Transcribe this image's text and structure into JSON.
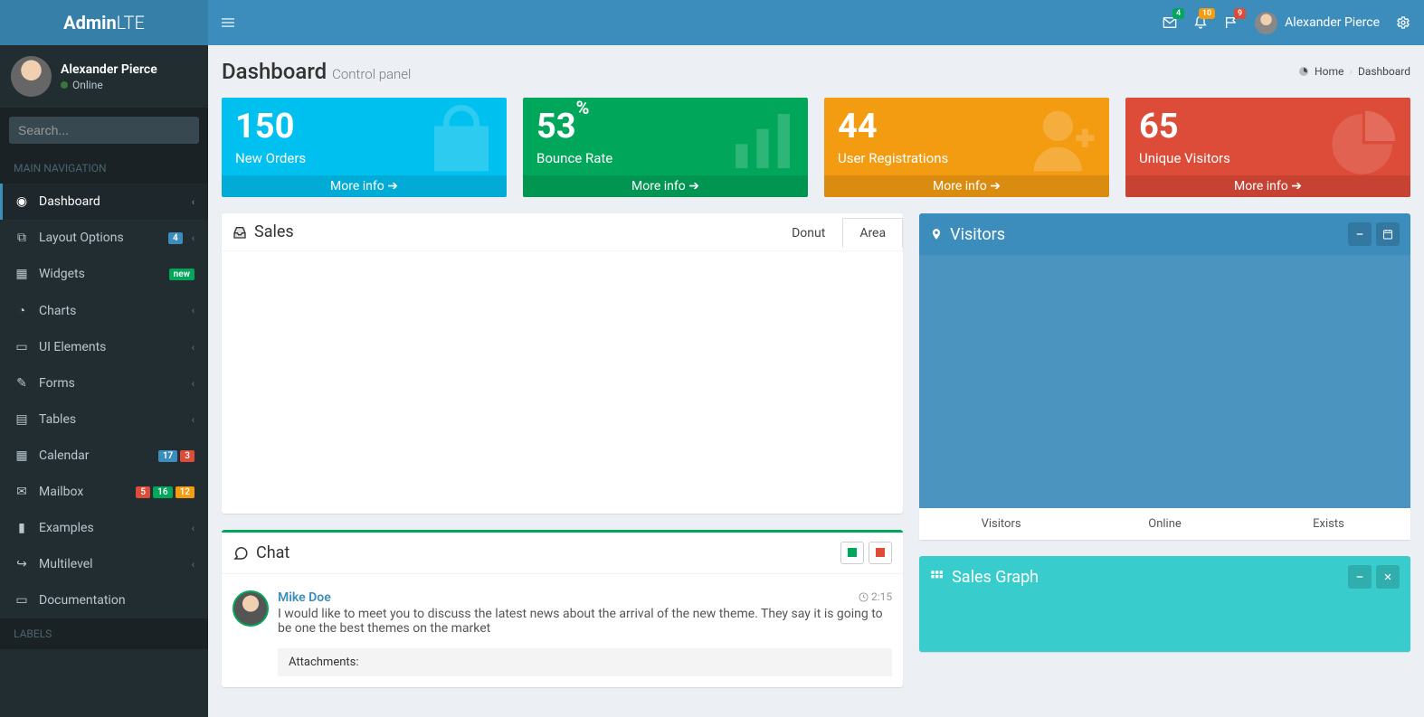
{
  "brand": {
    "a": "Admin",
    "b": "LTE"
  },
  "topbar": {
    "notif_msg_count": "4",
    "notif_bell_count": "10",
    "notif_flag_count": "9",
    "username": "Alexander Pierce"
  },
  "user_panel": {
    "name": "Alexander Pierce",
    "status": "Online"
  },
  "search": {
    "placeholder": "Search..."
  },
  "nav_header": "MAIN NAVIGATION",
  "sidebar": [
    {
      "icon": "◉",
      "label": "Dashboard",
      "active": true,
      "chev": true
    },
    {
      "icon": "⧉",
      "label": "Layout Options",
      "chev": true,
      "tags": [
        {
          "cls": "tag-blue",
          "t": "4"
        }
      ]
    },
    {
      "icon": "▦",
      "label": "Widgets",
      "tags": [
        {
          "cls": "tag-green",
          "t": "new"
        }
      ]
    },
    {
      "icon": "◔",
      "label": "Charts",
      "chev": true
    },
    {
      "icon": "▭",
      "label": "UI Elements",
      "chev": true
    },
    {
      "icon": "✎",
      "label": "Forms",
      "chev": true
    },
    {
      "icon": "▤",
      "label": "Tables",
      "chev": true
    },
    {
      "icon": "▦",
      "label": "Calendar",
      "tags": [
        {
          "cls": "tag-blue",
          "t": "17"
        },
        {
          "cls": "tag-red",
          "t": "3"
        }
      ]
    },
    {
      "icon": "✉",
      "label": "Mailbox",
      "tags": [
        {
          "cls": "tag-red",
          "t": "5"
        },
        {
          "cls": "tag-green",
          "t": "16"
        },
        {
          "cls": "tag-orange",
          "t": "12"
        }
      ]
    },
    {
      "icon": "▮",
      "label": "Examples",
      "chev": true
    },
    {
      "icon": "↪",
      "label": "Multilevel",
      "chev": true
    },
    {
      "icon": "▭",
      "label": "Documentation"
    }
  ],
  "labels_header": "LABELS",
  "page": {
    "title": "Dashboard",
    "subtitle": "Control panel"
  },
  "breadcrumb": {
    "home": "Home",
    "current": "Dashboard"
  },
  "stats": [
    {
      "cls": "sb-aqua",
      "value": "150",
      "suffix": "",
      "label": "New Orders",
      "more": "More info",
      "icon": "bag"
    },
    {
      "cls": "sb-green",
      "value": "53",
      "suffix": "%",
      "label": "Bounce Rate",
      "more": "More info",
      "icon": "bars"
    },
    {
      "cls": "sb-yellow",
      "value": "44",
      "suffix": "",
      "label": "User Registrations",
      "more": "More info",
      "icon": "user"
    },
    {
      "cls": "sb-red",
      "value": "65",
      "suffix": "",
      "label": "Unique Visitors",
      "more": "More info",
      "icon": "pie"
    }
  ],
  "sales": {
    "title": "Sales",
    "tabs": [
      "Donut",
      "Area"
    ],
    "active_tab": 0
  },
  "visitors": {
    "title": "Visitors",
    "footer": [
      "Visitors",
      "Online",
      "Exists"
    ]
  },
  "chat": {
    "title": "Chat",
    "msg": {
      "name": "Mike Doe",
      "time": "2:15",
      "text": "I would like to meet you to discuss the latest news about the arrival of the new theme. They say it is going to be one the best themes on the market",
      "attach": "Attachments:"
    }
  },
  "salesgraph": {
    "title": "Sales Graph"
  }
}
